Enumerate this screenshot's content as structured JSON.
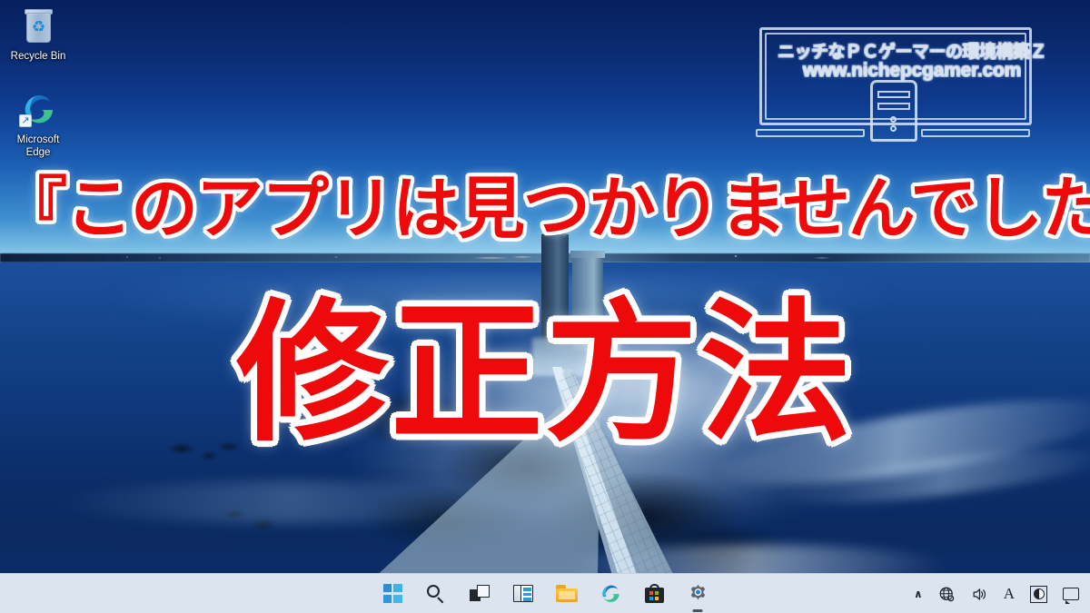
{
  "desktop": {
    "icons": [
      {
        "name": "recycle-bin",
        "label": "Recycle Bin",
        "icon": "recycle-bin-icon"
      },
      {
        "name": "microsoft-edge",
        "label": "Microsoft\nEdge",
        "label_line1": "Microsoft",
        "label_line2": "Edge",
        "icon": "edge-icon",
        "shortcut_badge": "↗"
      }
    ]
  },
  "watermark": {
    "site_title_jp": "ニッチなＰＣゲーマーの環境構築Ｚ",
    "site_url": "www.nichepcgamer.com",
    "logo_icon": "monitor-and-pc-tower-icon"
  },
  "overlay": {
    "headline_1": "『このアプリは見つかりませんでした』",
    "headline_2": "修正方法",
    "text_color": "#ee0a0a",
    "outline_color": "#ffffff"
  },
  "taskbar": {
    "background_color": "#dce4ef",
    "buttons": [
      {
        "name": "start",
        "label": "Start",
        "icon": "windows-start-icon",
        "active": false
      },
      {
        "name": "search",
        "label": "Search",
        "icon": "search-icon",
        "active": false
      },
      {
        "name": "task-view",
        "label": "Task View",
        "icon": "task-view-icon",
        "active": false
      },
      {
        "name": "widgets",
        "label": "Widgets",
        "icon": "widgets-icon",
        "active": false
      },
      {
        "name": "file-explorer",
        "label": "File Explorer",
        "icon": "folder-icon",
        "active": false
      },
      {
        "name": "microsoft-edge",
        "label": "Microsoft Edge",
        "icon": "edge-icon",
        "active": false
      },
      {
        "name": "microsoft-store",
        "label": "Microsoft Store",
        "icon": "store-bag-icon",
        "active": false
      },
      {
        "name": "settings",
        "label": "Settings",
        "icon": "gear-icon",
        "active": true
      }
    ],
    "tray": [
      {
        "name": "show-hidden-icons",
        "label": "Show hidden icons",
        "icon": "chevron-up-icon",
        "glyph": "∧"
      },
      {
        "name": "network",
        "label": "Network",
        "icon": "globe-network-icon"
      },
      {
        "name": "volume",
        "label": "Volume",
        "icon": "speaker-icon"
      },
      {
        "name": "ime-input-mode",
        "label": "IME input mode",
        "icon": "ime-letter-a-icon",
        "glyph": "A"
      },
      {
        "name": "ime-kana-toggle",
        "label": "IME conversion mode",
        "icon": "ime-half-circle-icon"
      },
      {
        "name": "notifications",
        "label": "Notifications",
        "icon": "chat-bubble-icon"
      }
    ]
  }
}
